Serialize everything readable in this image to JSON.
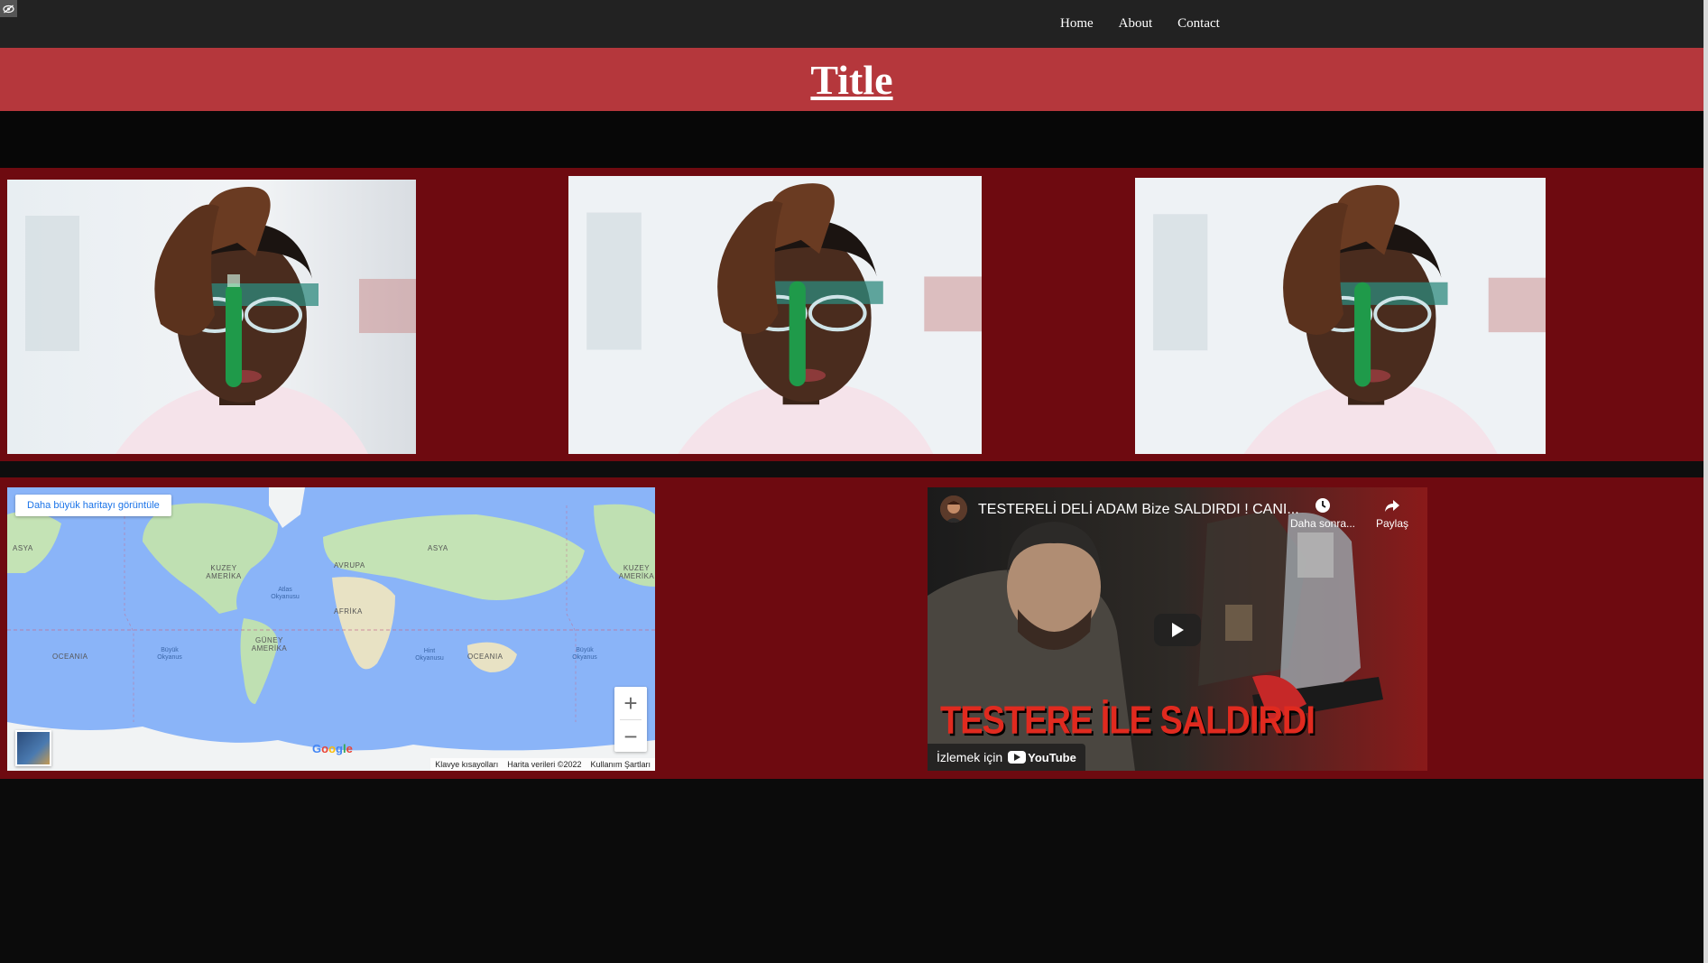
{
  "nav": {
    "links": [
      "Home",
      "About",
      "Contact"
    ]
  },
  "header": {
    "title": "Title"
  },
  "gallery": {
    "image_alt": "scientist holding test tube",
    "count": 3
  },
  "map": {
    "larger_map_button": "Daha büyük haritayı görüntüle",
    "zoom_in": "+",
    "zoom_out": "−",
    "logo": "Google",
    "footer": {
      "shortcuts": "Klavye kısayolları",
      "data": "Harita verileri ©2022",
      "terms": "Kullanım Şartları"
    },
    "continent_labels": [
      "ASYA",
      "KUZEY AMERİKA",
      "AVRUPA",
      "ASYA",
      "KUZEY AMERİKA",
      "AFRİKA",
      "GÜNEY AMERİKA",
      "OCEANIA",
      "OCEANIA"
    ],
    "ocean_labels": [
      "Atlas Okyanusu",
      "Büyük Okyanus",
      "Hint Okyanusu",
      "Büyük Okyanus"
    ]
  },
  "video": {
    "title": "TESTERELİ DELİ ADAM Bize SALDIRDI ! CANI...",
    "watch_later": "Daha sonra...",
    "share": "Paylaş",
    "overlay_text": "TESTERE İLE SALDIRDI",
    "watch_on": "İzlemek için",
    "youtube": "YouTube"
  },
  "colors": {
    "navbar": "#222222",
    "header": "#b5373c",
    "section": "#6e0a10",
    "page": "#0b0b0b"
  }
}
